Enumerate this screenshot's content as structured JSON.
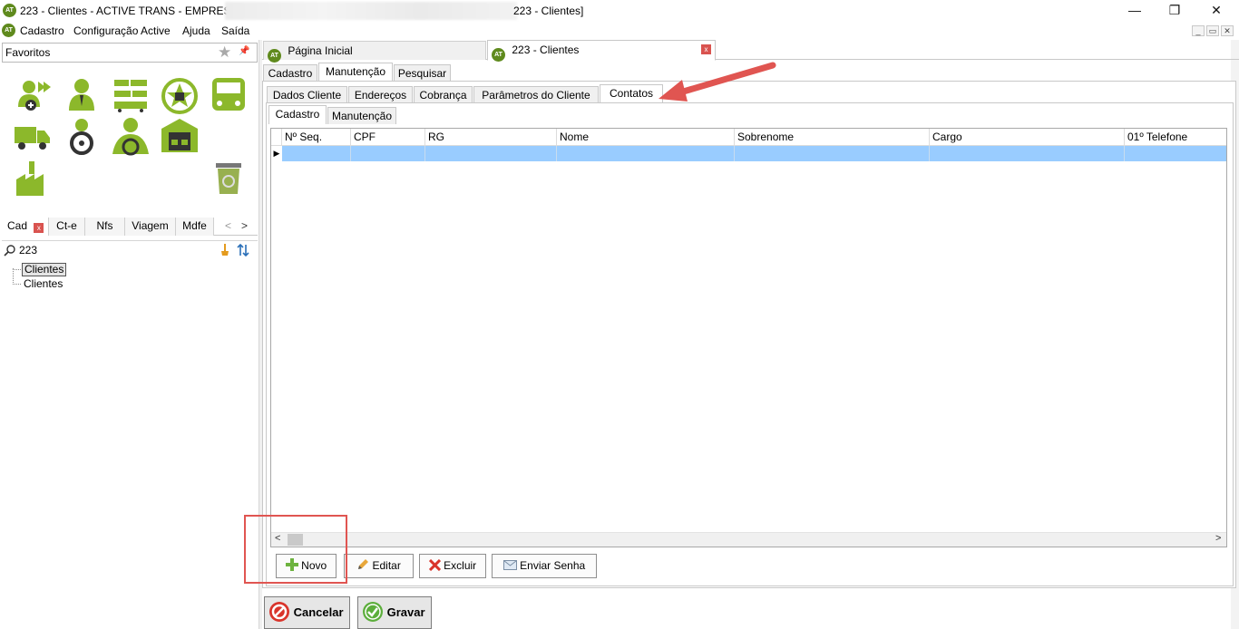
{
  "window": {
    "title_prefix": "223 - Clientes - ACTIVE TRANS - EMPRESA:",
    "title_suffix": "223 - Clientes]",
    "logo_text": "AT",
    "minimize": "—",
    "restore": "❐",
    "close": "✕"
  },
  "menu": {
    "items": [
      "Cadastro",
      "Configuração Active",
      "Ajuda",
      "Saída"
    ],
    "mdi_buttons": [
      "_",
      "▭",
      "✕"
    ]
  },
  "sidebar": {
    "favorites_label": "Favoritos",
    "icons": [
      "add-user-icon",
      "person-icon",
      "truck-fleet-icon",
      "steering-wheel-icon",
      "bus-icon",
      "delivery-truck-icon",
      "driver-icon",
      "driver-car-icon",
      "warehouse-icon",
      "factory-icon",
      "recycle-bin-icon"
    ],
    "category_tabs": [
      "Cad",
      "Ct-e",
      "Nfs",
      "Viagem",
      "Mdfe"
    ],
    "search_value": "223",
    "tree_items": [
      "Clientes",
      "Clientes"
    ]
  },
  "doc_tabs": {
    "home": "Página Inicial",
    "current": "223 - Clientes"
  },
  "outer_tabs": [
    "Cadastro",
    "Manutenção",
    "Pesquisar"
  ],
  "inner_tabs": [
    "Dados Cliente",
    "Endereços",
    "Cobrança",
    "Parâmetros do Cliente",
    "Contatos"
  ],
  "sub_tabs": [
    "Cadastro",
    "Manutenção"
  ],
  "grid": {
    "columns": [
      "Nº Seq.",
      "CPF",
      "RG",
      "Nome",
      "Sobrenome",
      "Cargo",
      "01º Telefone"
    ],
    "selected_row_indicator": "▶",
    "selected_row_color": "#99ccff"
  },
  "actions": {
    "novo": "Novo",
    "editar": "Editar",
    "excluir": "Excluir",
    "enviar_senha": "Enviar Senha"
  },
  "footer": {
    "cancelar": "Cancelar",
    "gravar": "Gravar"
  },
  "colors": {
    "brand_green": "#5f8a1d",
    "icon_green": "#8cb82b",
    "arrow_red": "#e05551",
    "selection_blue": "#99ccff"
  }
}
